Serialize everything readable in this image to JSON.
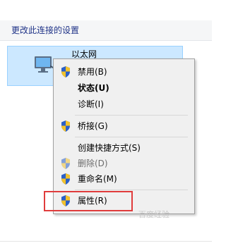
{
  "toolbar": {
    "command": "更改此连接的设置"
  },
  "connection": {
    "name": "以太网",
    "icon": "network-adapter-icon"
  },
  "context_menu": {
    "items": [
      {
        "label": "禁用(B)",
        "icon": "uac-shield-icon"
      },
      {
        "label": "状态(U)",
        "default": true
      },
      {
        "label": "诊断(I)"
      },
      {
        "label": "桥接(G)",
        "icon": "uac-shield-icon"
      },
      {
        "label": "创建快捷方式(S)"
      },
      {
        "label": "删除(D)",
        "icon": "uac-shield-icon",
        "disabled": true
      },
      {
        "label": "重命名(M)",
        "icon": "uac-shield-icon"
      },
      {
        "label": "属性(R)",
        "icon": "uac-shield-icon",
        "highlighted": true
      }
    ]
  },
  "colors": {
    "selection_bg": "#cce8ff",
    "selection_border": "#99d1ff",
    "highlight_box": "#e03c3c",
    "toolbar_link": "#1e3287"
  },
  "watermark": "百度经验"
}
